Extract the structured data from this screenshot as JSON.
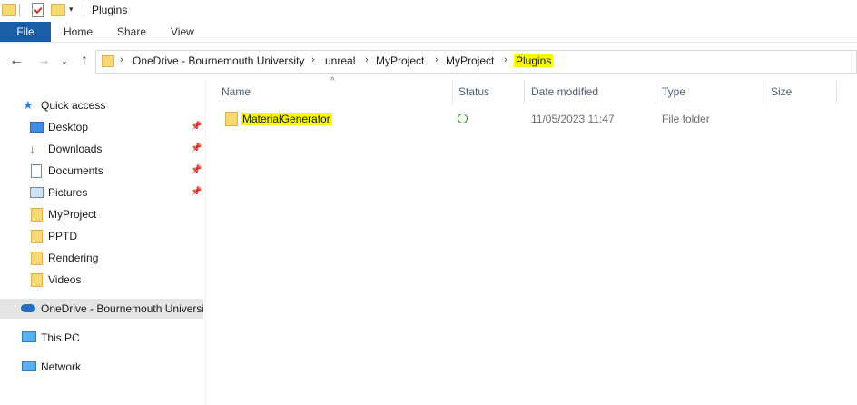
{
  "window": {
    "title": "Plugins"
  },
  "ribbon": {
    "tabs": [
      "File",
      "Home",
      "Share",
      "View"
    ]
  },
  "address": {
    "crumbs": [
      "OneDrive - Bournemouth University",
      "unreal",
      "MyProject",
      "MyProject",
      "Plugins"
    ]
  },
  "navpane": {
    "quick_access": "Quick access",
    "items": [
      {
        "label": "Desktop",
        "icon": "desktop-icon",
        "pinned": true
      },
      {
        "label": "Downloads",
        "icon": "downloads-icon",
        "pinned": true
      },
      {
        "label": "Documents",
        "icon": "documents-icon",
        "pinned": true
      },
      {
        "label": "Pictures",
        "icon": "pictures-icon",
        "pinned": true
      },
      {
        "label": "MyProject",
        "icon": "folder-icon",
        "pinned": false
      },
      {
        "label": "PPTD",
        "icon": "folder-icon",
        "pinned": false
      },
      {
        "label": "Rendering",
        "icon": "folder-icon",
        "pinned": false
      },
      {
        "label": "Videos",
        "icon": "folder-icon",
        "pinned": false
      }
    ],
    "onedrive": "OneDrive - Bournemouth University",
    "this_pc": "This PC",
    "network": "Network"
  },
  "columns": {
    "name": "Name",
    "status": "Status",
    "date": "Date modified",
    "type": "Type",
    "size": "Size"
  },
  "files": [
    {
      "name": "MaterialGenerator",
      "date": "11/05/2023 11:47",
      "type": "File folder",
      "size": ""
    }
  ],
  "colors": {
    "accent": "#1a5ea8",
    "highlight": "#f7f700",
    "folder": "#f8d775"
  }
}
